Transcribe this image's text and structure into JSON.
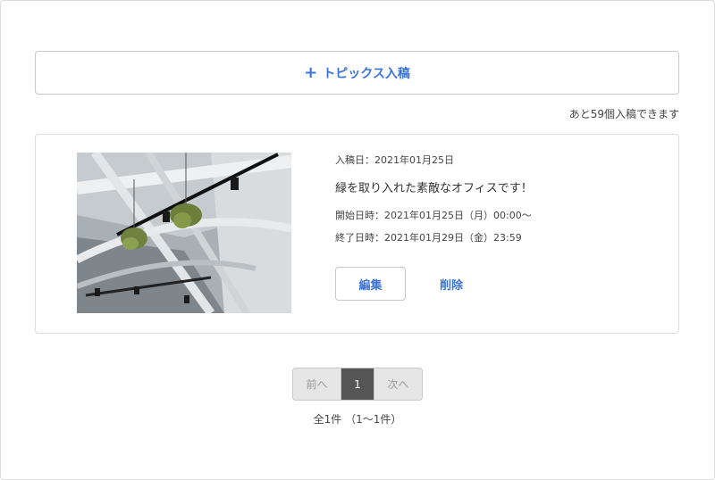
{
  "add_button": {
    "icon": "plus-icon",
    "plus": "+",
    "label": "トピックス入稿"
  },
  "remaining_text": "あと59個入稿できます",
  "topics": [
    {
      "image_icon": "office-ceiling-photo",
      "post_date": "入稿日：2021年01月25日",
      "title": "緑を取り入れた素敵なオフィスです！",
      "start_time": "開始日時：2021年01月25日（月）00:00～",
      "end_time": "終了日時：2021年01月29日（金）23:59",
      "edit_label": "編集",
      "delete_label": "削除"
    }
  ],
  "pagination": {
    "prev": "前へ",
    "current": "1",
    "next": "次へ"
  },
  "total_text": "全1件 （1〜1件）",
  "colors": {
    "accent": "#3a73d9",
    "current_page_bg": "#555555",
    "disabled_bg": "#e6e6e6"
  }
}
